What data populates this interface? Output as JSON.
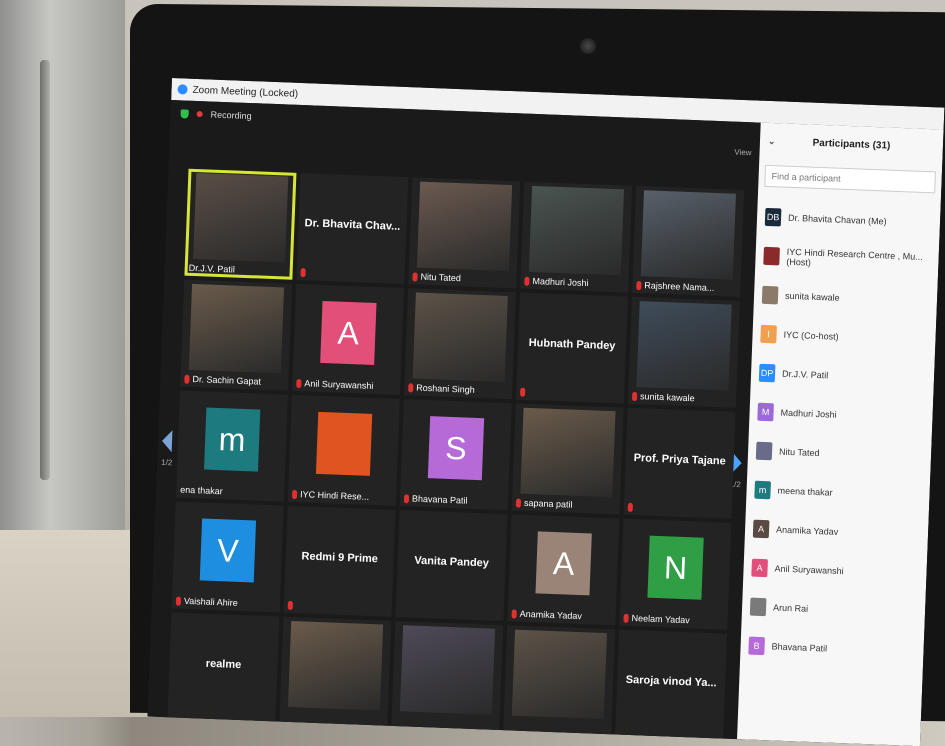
{
  "window": {
    "title": "Zoom Meeting (Locked)",
    "recording": "Recording",
    "view": "View"
  },
  "colors": {
    "active_speaker": "#d6e637",
    "muted": "#e03030",
    "zoom_blue": "#2d8cff"
  },
  "grid": {
    "tiles": [
      {
        "name": "Dr.J.V. Patil",
        "kind": "video",
        "active": true
      },
      {
        "name": "Dr. Bhavita Chav...",
        "kind": "name",
        "center": true,
        "muted": true
      },
      {
        "name": "Nitu Tated",
        "kind": "video",
        "muted": true
      },
      {
        "name": "Madhuri Joshi",
        "kind": "video",
        "muted": true
      },
      {
        "name": "Rajshree Nama...",
        "kind": "video",
        "muted": true
      },
      {
        "name": "Dr. Sachin Gapat",
        "kind": "video",
        "muted": true
      },
      {
        "name": "Anil Suryawanshi",
        "kind": "avatar",
        "letter": "A",
        "color": "#e2507a",
        "muted": true
      },
      {
        "name": "Roshani Singh",
        "kind": "video",
        "muted": true
      },
      {
        "name": "Hubnath Pandey",
        "kind": "name",
        "center": true,
        "muted": true
      },
      {
        "name": "sunita kawale",
        "kind": "video",
        "muted": true
      },
      {
        "name": "ena thakar",
        "kind": "avatar",
        "letter": "m",
        "color": "#1d7a7f"
      },
      {
        "name": "IYC Hindi Rese...",
        "kind": "logo",
        "color": "#e0541f",
        "muted": true
      },
      {
        "name": "Bhavana Patil",
        "kind": "avatar",
        "letter": "S",
        "color": "#b56ad8",
        "muted": true
      },
      {
        "name": "sapana patil",
        "kind": "video",
        "muted": true
      },
      {
        "name": "Prof. Priya Tajane",
        "kind": "name",
        "center": true,
        "muted": true
      },
      {
        "name": "Vaishali Ahire",
        "kind": "avatar",
        "letter": "V",
        "color": "#1e8fe0",
        "muted": true
      },
      {
        "name": "Redmi 9 Prime",
        "kind": "name",
        "center": true,
        "muted": true
      },
      {
        "name": "Vanita Pandey",
        "kind": "name",
        "center": true
      },
      {
        "name": "Anamika Yadav",
        "kind": "avatar",
        "letter": "A",
        "color": "#9a8478",
        "muted": true
      },
      {
        "name": "Neelam Yadav",
        "kind": "avatar",
        "letter": "N",
        "color": "#2f9e44",
        "muted": true
      },
      {
        "name": "realme",
        "kind": "name",
        "center": true
      },
      {
        "name": "",
        "kind": "video"
      },
      {
        "name": "",
        "kind": "video"
      },
      {
        "name": "",
        "kind": "video"
      },
      {
        "name": "Saroja vinod Ya...",
        "kind": "name",
        "center": true
      }
    ],
    "page": "1/2"
  },
  "panel": {
    "title": "Participants (31)",
    "search_placeholder": "Find a participant",
    "participants": [
      {
        "name": "Dr. Bhavita Chavan (Me)",
        "initials": "DB",
        "color": "#1b2a3a"
      },
      {
        "name": "IYC Hindi Research Centre , Mu...  (Host)",
        "initials": "",
        "color": "#8b2a2a"
      },
      {
        "name": "sunita kawale",
        "initials": "",
        "color": "#8a7a6a"
      },
      {
        "name": "IYC (Co-host)",
        "initials": "I",
        "color": "#f0a050"
      },
      {
        "name": "Dr.J.V. Patil",
        "initials": "DP",
        "color": "#2d8cff"
      },
      {
        "name": "Madhuri Joshi",
        "initials": "M",
        "color": "#9b6ad8"
      },
      {
        "name": "Nitu Tated",
        "initials": "",
        "color": "#6a6a8a"
      },
      {
        "name": "meena thakar",
        "initials": "m",
        "color": "#1d7a7f"
      },
      {
        "name": "Anamika Yadav",
        "initials": "A",
        "color": "#5a4a44"
      },
      {
        "name": "Anil Suryawanshi",
        "initials": "A",
        "color": "#e2507a"
      },
      {
        "name": "Arun Rai",
        "initials": "",
        "color": "#7a7a7a"
      },
      {
        "name": "Bhavana Patil",
        "initials": "B",
        "color": "#b56ad8"
      }
    ]
  }
}
